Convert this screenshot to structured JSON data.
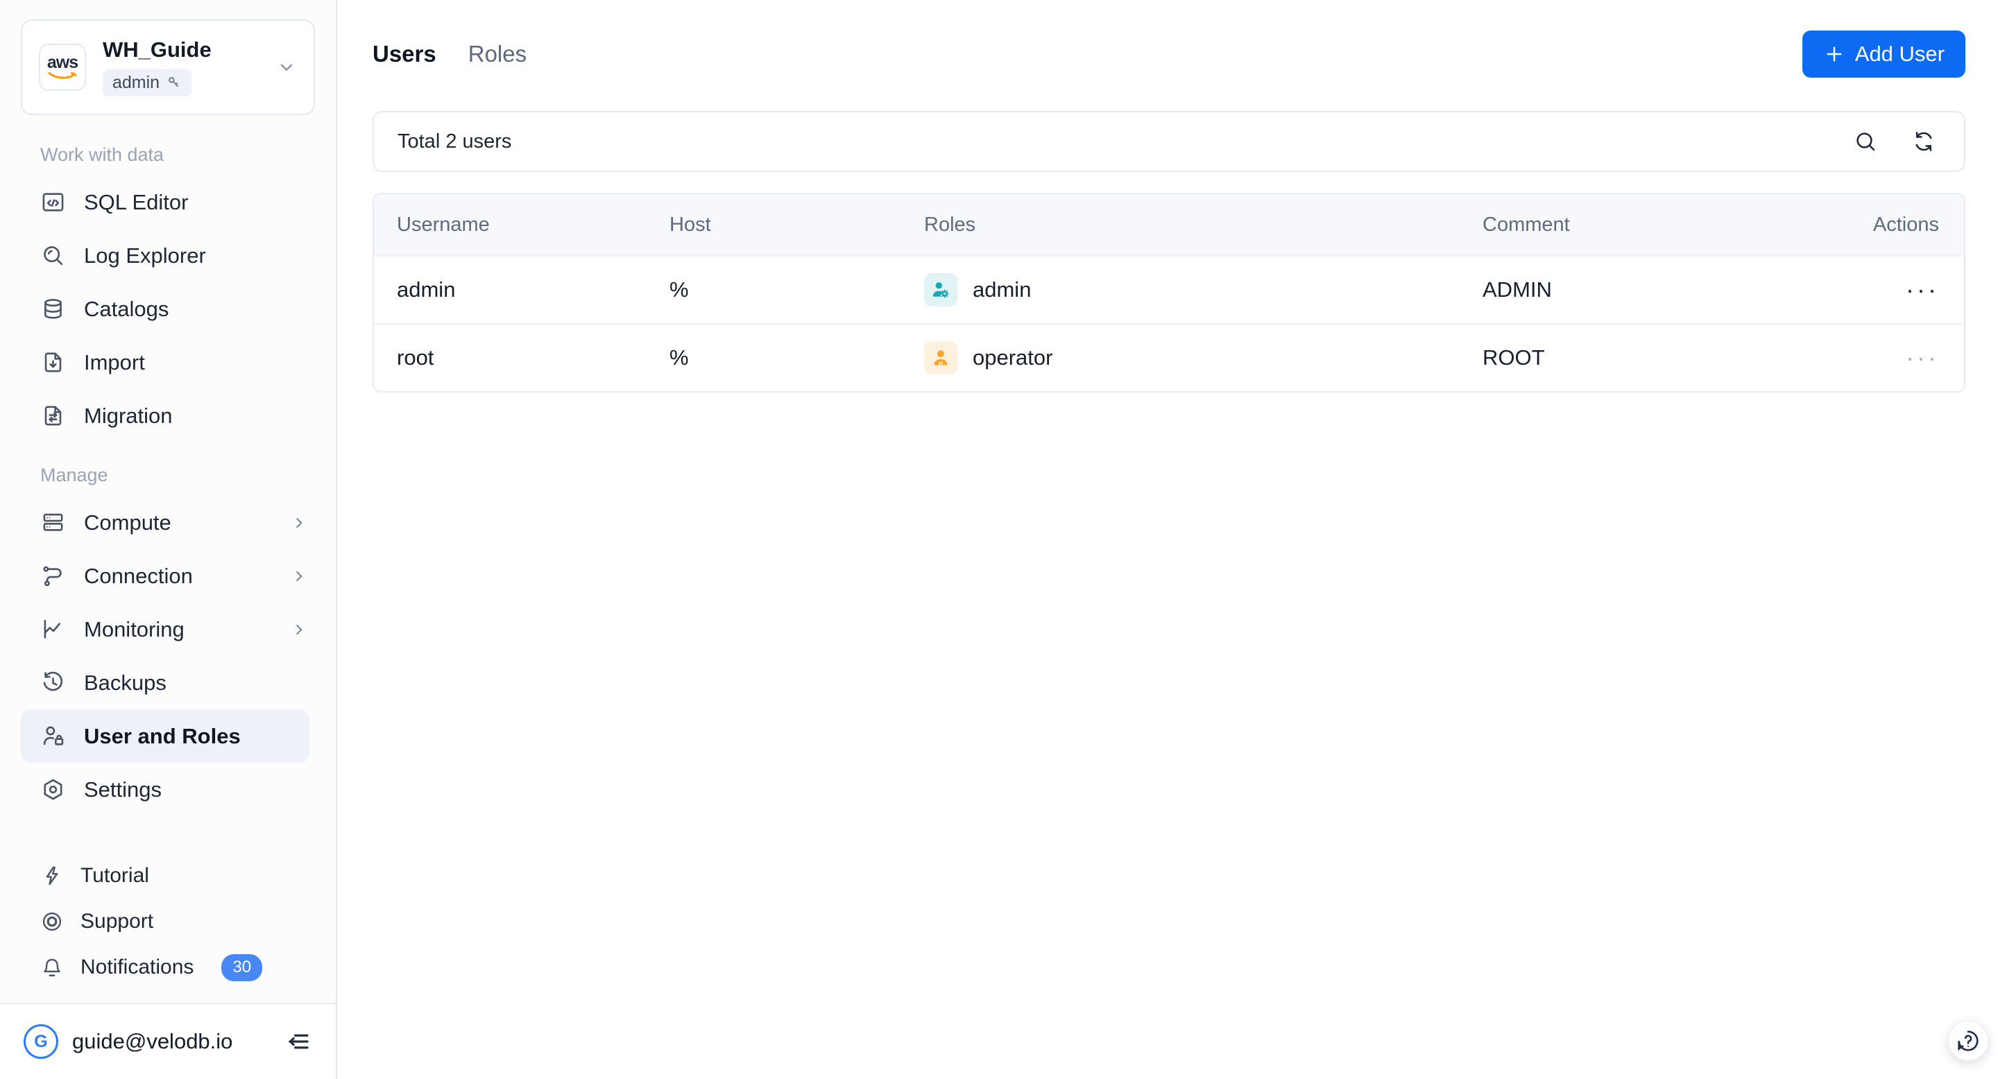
{
  "workspace": {
    "name": "WH_Guide",
    "badge": "admin",
    "logo_text": "aws"
  },
  "sidebar": {
    "sections": [
      {
        "label": "Work with data",
        "items": [
          {
            "label": "SQL Editor",
            "icon": "sql-editor-icon"
          },
          {
            "label": "Log Explorer",
            "icon": "log-explorer-icon"
          },
          {
            "label": "Catalogs",
            "icon": "catalogs-icon"
          },
          {
            "label": "Import",
            "icon": "import-icon"
          },
          {
            "label": "Migration",
            "icon": "migration-icon"
          }
        ]
      },
      {
        "label": "Manage",
        "items": [
          {
            "label": "Compute",
            "icon": "compute-icon",
            "has_submenu": true
          },
          {
            "label": "Connection",
            "icon": "connection-icon",
            "has_submenu": true
          },
          {
            "label": "Monitoring",
            "icon": "monitoring-icon",
            "has_submenu": true
          },
          {
            "label": "Backups",
            "icon": "backups-icon"
          },
          {
            "label": "User and Roles",
            "icon": "user-roles-icon",
            "selected": true
          },
          {
            "label": "Settings",
            "icon": "settings-icon"
          }
        ]
      }
    ],
    "utility_items": [
      {
        "label": "Tutorial",
        "icon": "tutorial-icon"
      },
      {
        "label": "Support",
        "icon": "support-icon"
      },
      {
        "label": "Notifications",
        "icon": "bell-icon",
        "badge": "30"
      }
    ],
    "account": {
      "initial": "G",
      "email": "guide@velodb.io"
    }
  },
  "main": {
    "tabs": [
      {
        "label": "Users",
        "active": true
      },
      {
        "label": "Roles",
        "active": false
      }
    ],
    "add_user": {
      "label": "Add User"
    },
    "toolbar": {
      "total": "Total 2 users"
    },
    "table": {
      "columns": [
        "Username",
        "Host",
        "Roles",
        "Comment",
        "Actions"
      ],
      "rows": [
        {
          "username": "admin",
          "host": "%",
          "role": "admin",
          "role_icon": "role-admin-icon",
          "comment": "ADMIN",
          "actions": "···"
        },
        {
          "username": "root",
          "host": "%",
          "role": "operator",
          "role_icon": "role-operator-icon",
          "comment": "ROOT",
          "actions": "···"
        }
      ]
    }
  },
  "colors": {
    "accent_blue": "#0D6BF3",
    "notification_badge_blue": "#4787F6",
    "role_admin_teal": "#19A5B8",
    "role_admin_bg": "#E2F3F5",
    "role_operator_orange": "#F5A62B",
    "role_operator_bg": "#FDF0DC",
    "aws_orange": "#FF9900",
    "selected_item_bg": "#EEF1F8"
  }
}
